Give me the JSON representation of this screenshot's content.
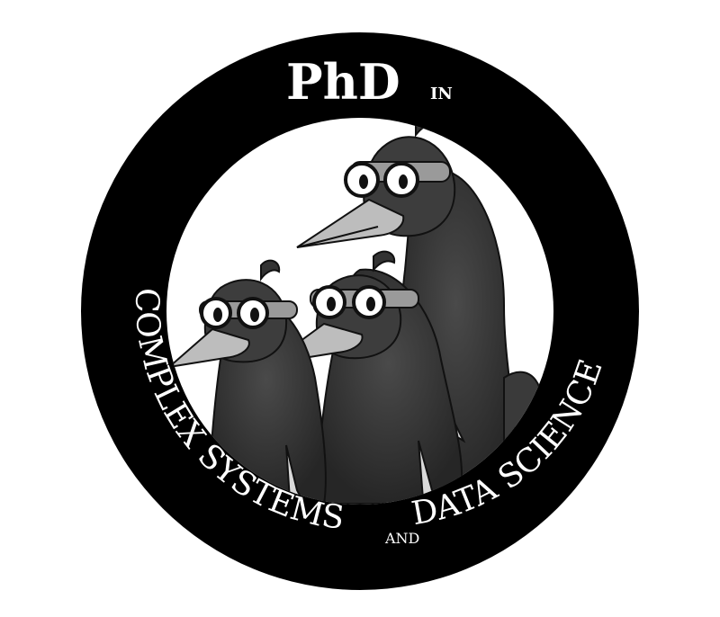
{
  "logo": {
    "title_main": "PhD",
    "title_small": "IN",
    "arc_text_left": "COMPLEX SYSTEMS",
    "arc_text_and": "AND",
    "arc_text_right": "DATA SCIENCE",
    "ring_color": "#000000",
    "inner_color": "#ffffff",
    "mascot": "three-cartoon-birds-with-goggles"
  }
}
